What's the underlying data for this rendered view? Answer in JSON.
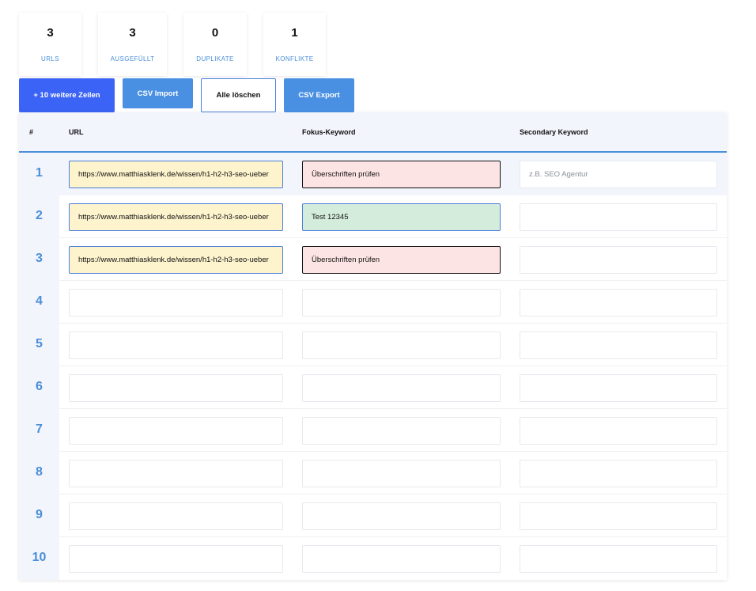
{
  "stats": [
    {
      "value": "3",
      "label": "URLS"
    },
    {
      "value": "3",
      "label": "AUSGEFÜLLT"
    },
    {
      "value": "0",
      "label": "DUPLIKATE"
    },
    {
      "value": "1",
      "label": "KONFLIKTE"
    }
  ],
  "toolbar": {
    "add_rows_label": "+ 10 weitere Zeilen",
    "csv_import_label": "CSV Import",
    "clear_all_label": "Alle löschen",
    "csv_export_label": "CSV Export"
  },
  "table": {
    "headers": {
      "num": "#",
      "url": "URL",
      "focus": "Fokus-Keyword",
      "secondary": "Secondary Keyword"
    },
    "secondary_placeholder": "z.B. SEO Agentur",
    "rows": [
      {
        "num": "1",
        "url": "https://www.matthiasklenk.de/wissen/h1-h2-h3-seo-ueber",
        "focus": "Überschriften prüfen",
        "secondary": ""
      },
      {
        "num": "2",
        "url": "https://www.matthiasklenk.de/wissen/h1-h2-h3-seo-ueber",
        "focus": "Test 12345",
        "secondary": ""
      },
      {
        "num": "3",
        "url": "https://www.matthiasklenk.de/wissen/h1-h2-h3-seo-ueber",
        "focus": "Überschriften prüfen",
        "secondary": ""
      },
      {
        "num": "4",
        "url": "",
        "focus": "",
        "secondary": ""
      },
      {
        "num": "5",
        "url": "",
        "focus": "",
        "secondary": ""
      },
      {
        "num": "6",
        "url": "",
        "focus": "",
        "secondary": ""
      },
      {
        "num": "7",
        "url": "",
        "focus": "",
        "secondary": ""
      },
      {
        "num": "8",
        "url": "",
        "focus": "",
        "secondary": ""
      },
      {
        "num": "9",
        "url": "",
        "focus": "",
        "secondary": ""
      },
      {
        "num": "10",
        "url": "",
        "focus": "",
        "secondary": ""
      }
    ]
  },
  "colors": {
    "accent": "#4a8fd8",
    "primary_button": "#3b63f5",
    "url_filled": "#fdf3cd",
    "keyword_conflict": "#fde4e4",
    "keyword_ok": "#d4ecdc"
  }
}
